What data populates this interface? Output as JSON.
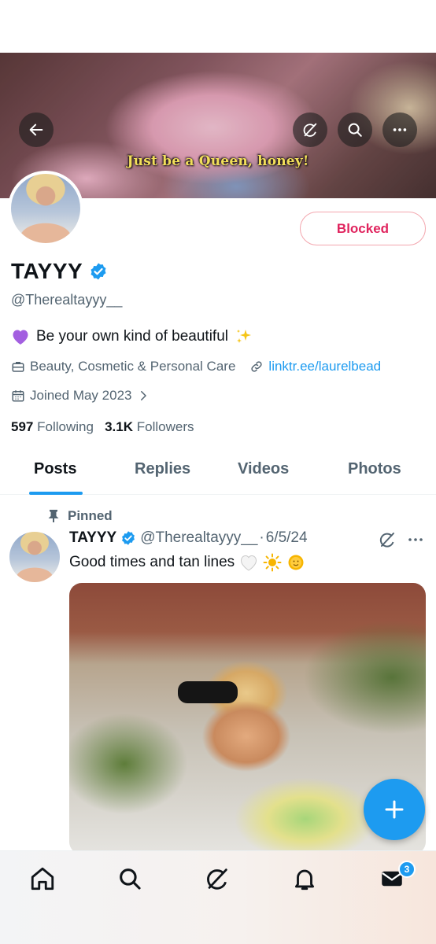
{
  "banner": {
    "caption": "Just be a Queen, honey!",
    "back_icon": "arrow-left-icon",
    "grok_icon": "grok-slash-icon",
    "search_icon": "search-icon",
    "more_icon": "more-horizontal-icon"
  },
  "profile": {
    "name": "TAYYY",
    "handle": "@Therealtayyy__",
    "blocked_label": "Blocked",
    "bio_text": "Be your own kind of beautiful",
    "category": "Beauty, Cosmetic & Personal Care",
    "link": "linktr.ee/laurelbead",
    "joined": "Joined May 2023",
    "following_count": "597",
    "following_label": "Following",
    "followers_count": "3.1K",
    "followers_label": "Followers"
  },
  "tabs": [
    {
      "label": "Posts"
    },
    {
      "label": "Replies"
    },
    {
      "label": "Videos"
    },
    {
      "label": "Photos"
    }
  ],
  "post": {
    "pinned_label": "Pinned",
    "author_name": "TAYYY",
    "author_handle": "@Therealtayyy__",
    "separator": "·",
    "date": "6/5/24",
    "text": "Good times and tan lines"
  },
  "nav": {
    "messages_badge": "3"
  },
  "colors": {
    "accent": "#1d9bf0",
    "blocked_red": "#e0245e",
    "secondary_text": "#536471"
  }
}
